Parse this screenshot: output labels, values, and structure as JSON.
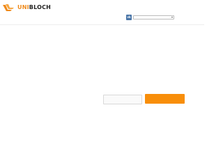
{
  "brand": {
    "logo_part1": "UNI",
    "logo_part2": "BLOCH",
    "accent_color": "#ef8a1b"
  },
  "header": {
    "language_icon": "vk-icon",
    "language_select_value": ""
  },
  "form": {
    "input_value": "",
    "input_placeholder": "",
    "button_label": "",
    "button_color": "#f88e0a"
  }
}
